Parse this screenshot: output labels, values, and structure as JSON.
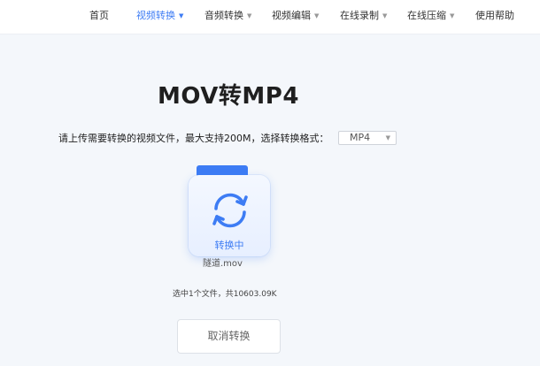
{
  "nav": {
    "items": [
      {
        "label": "首页",
        "dropdown": false,
        "active": false
      },
      {
        "label": "视频转换",
        "dropdown": true,
        "active": true
      },
      {
        "label": "音频转换",
        "dropdown": true,
        "active": false
      },
      {
        "label": "视频编辑",
        "dropdown": true,
        "active": false
      },
      {
        "label": "在线录制",
        "dropdown": true,
        "active": false
      },
      {
        "label": "在线压缩",
        "dropdown": true,
        "active": false
      },
      {
        "label": "使用帮助",
        "dropdown": false,
        "active": false
      }
    ],
    "caret_glyph": "▼"
  },
  "main": {
    "title": "MOV转MP4",
    "instruction": "请上传需要转换的视频文件，最大支持200M，选择转换格式：",
    "format_select": {
      "value": "MP4"
    },
    "file_card": {
      "status": "转换中",
      "icon": "sync-icon"
    },
    "file_name": "隧道.mov",
    "file_summary": "选中1个文件，共10603.09K",
    "cancel_label": "取消转换"
  },
  "colors": {
    "accent": "#3d7cf4",
    "background": "#f4f7fb"
  }
}
